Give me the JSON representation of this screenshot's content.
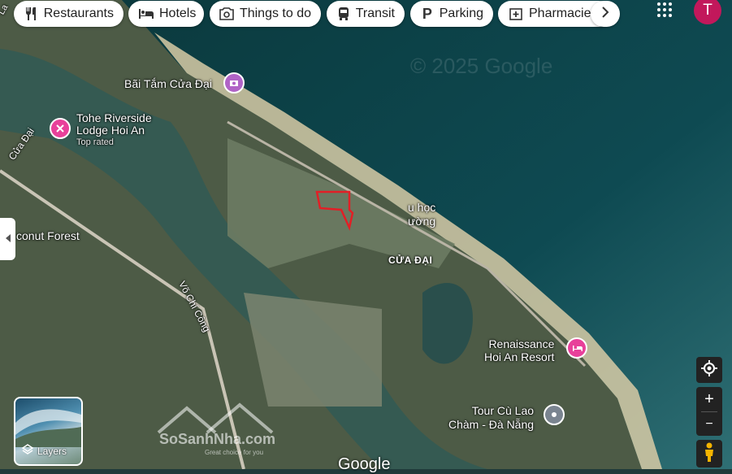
{
  "chips": [
    {
      "label": "Restaurants",
      "icon": "fork-knife-icon"
    },
    {
      "label": "Hotels",
      "icon": "bed-icon"
    },
    {
      "label": "Things to do",
      "icon": "camera-icon"
    },
    {
      "label": "Transit",
      "icon": "bus-icon"
    },
    {
      "label": "Parking",
      "icon": "parking-icon"
    },
    {
      "label": "Pharmacies",
      "icon": "pharmacy-icon"
    }
  ],
  "account": {
    "initial": "T",
    "color": "#c2185b"
  },
  "places": {
    "beach": "Bãi Tắm Cửa Đại",
    "lodge": "Tohe Riverside Lodge Hoi An",
    "lodge_sub": "Top rated",
    "school_1": "u học",
    "school_2": "ường",
    "cua_dai": "CỬA ĐẠI",
    "coconut": "conut Forest",
    "resort_1": "Renaissance",
    "resort_2": "Hoi An Resort",
    "tour_1": "Tour Cù Lao",
    "tour_2": "Chàm - Đà Nẵng",
    "road_vo_chi_cong": "Võ Chí Công",
    "road_cua_dai": "Cửa Đại",
    "edge_la": "La"
  },
  "layers_label": "Layers",
  "copyright": "© 2025 Google",
  "google_logo": "Google",
  "watermark": {
    "name": "SoSanhNha.com",
    "tag": "Great choice for you"
  },
  "colors": {
    "sea_deep": "#0e3a44",
    "sea_mid": "#1f5a62",
    "land": "#5d6b55",
    "pink_pin": "#e8409a",
    "grey_pin": "#7a8490",
    "boundary": "#e21f26"
  }
}
